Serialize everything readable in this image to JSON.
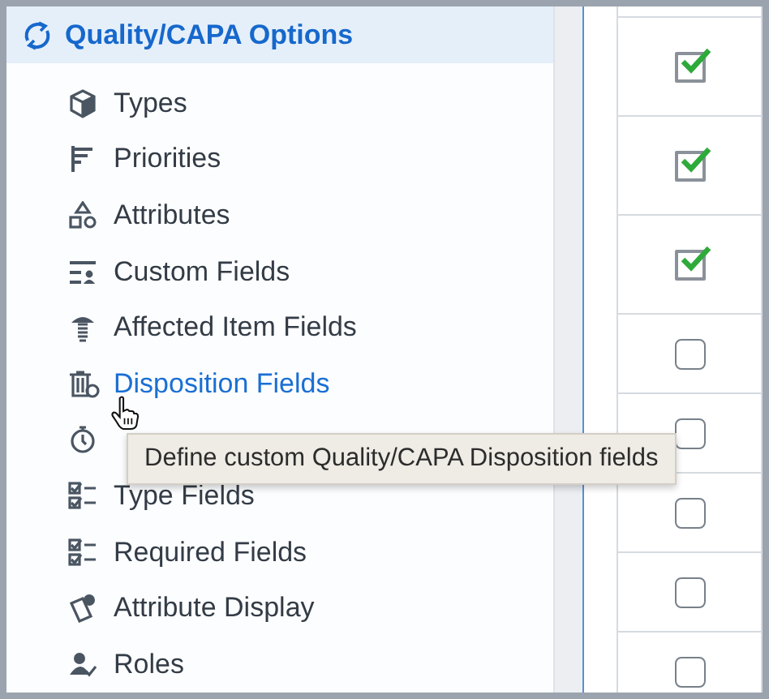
{
  "sidebar": {
    "header": "Quality/CAPA Options",
    "items": [
      {
        "kind": "entry",
        "label": "Types",
        "hovered": false
      },
      {
        "kind": "entry",
        "label": "Priorities",
        "hovered": false
      },
      {
        "kind": "entry",
        "label": "Attributes",
        "hovered": false
      },
      {
        "kind": "entry",
        "label": "Custom Fields",
        "hovered": false
      },
      {
        "kind": "entry",
        "label": "Affected Item Fields",
        "hovered": false
      },
      {
        "kind": "entry",
        "label": "Disposition Fields",
        "hovered": true
      },
      {
        "kind": "covered"
      },
      {
        "kind": "entry",
        "label": "Type Fields",
        "hovered": false
      },
      {
        "kind": "entry",
        "label": "Required Fields",
        "hovered": false
      },
      {
        "kind": "entry",
        "label": "Attribute Display",
        "hovered": false
      },
      {
        "kind": "entry",
        "label": "Roles",
        "hovered": false
      }
    ]
  },
  "tooltip": "Define custom Quality/CAPA Disposition fields",
  "checkboxes": [
    {
      "checked": true
    },
    {
      "checked": true
    },
    {
      "checked": true
    },
    {
      "checked": false
    },
    {
      "checked": false
    },
    {
      "checked": false
    },
    {
      "checked": false
    },
    {
      "checked": false
    }
  ]
}
